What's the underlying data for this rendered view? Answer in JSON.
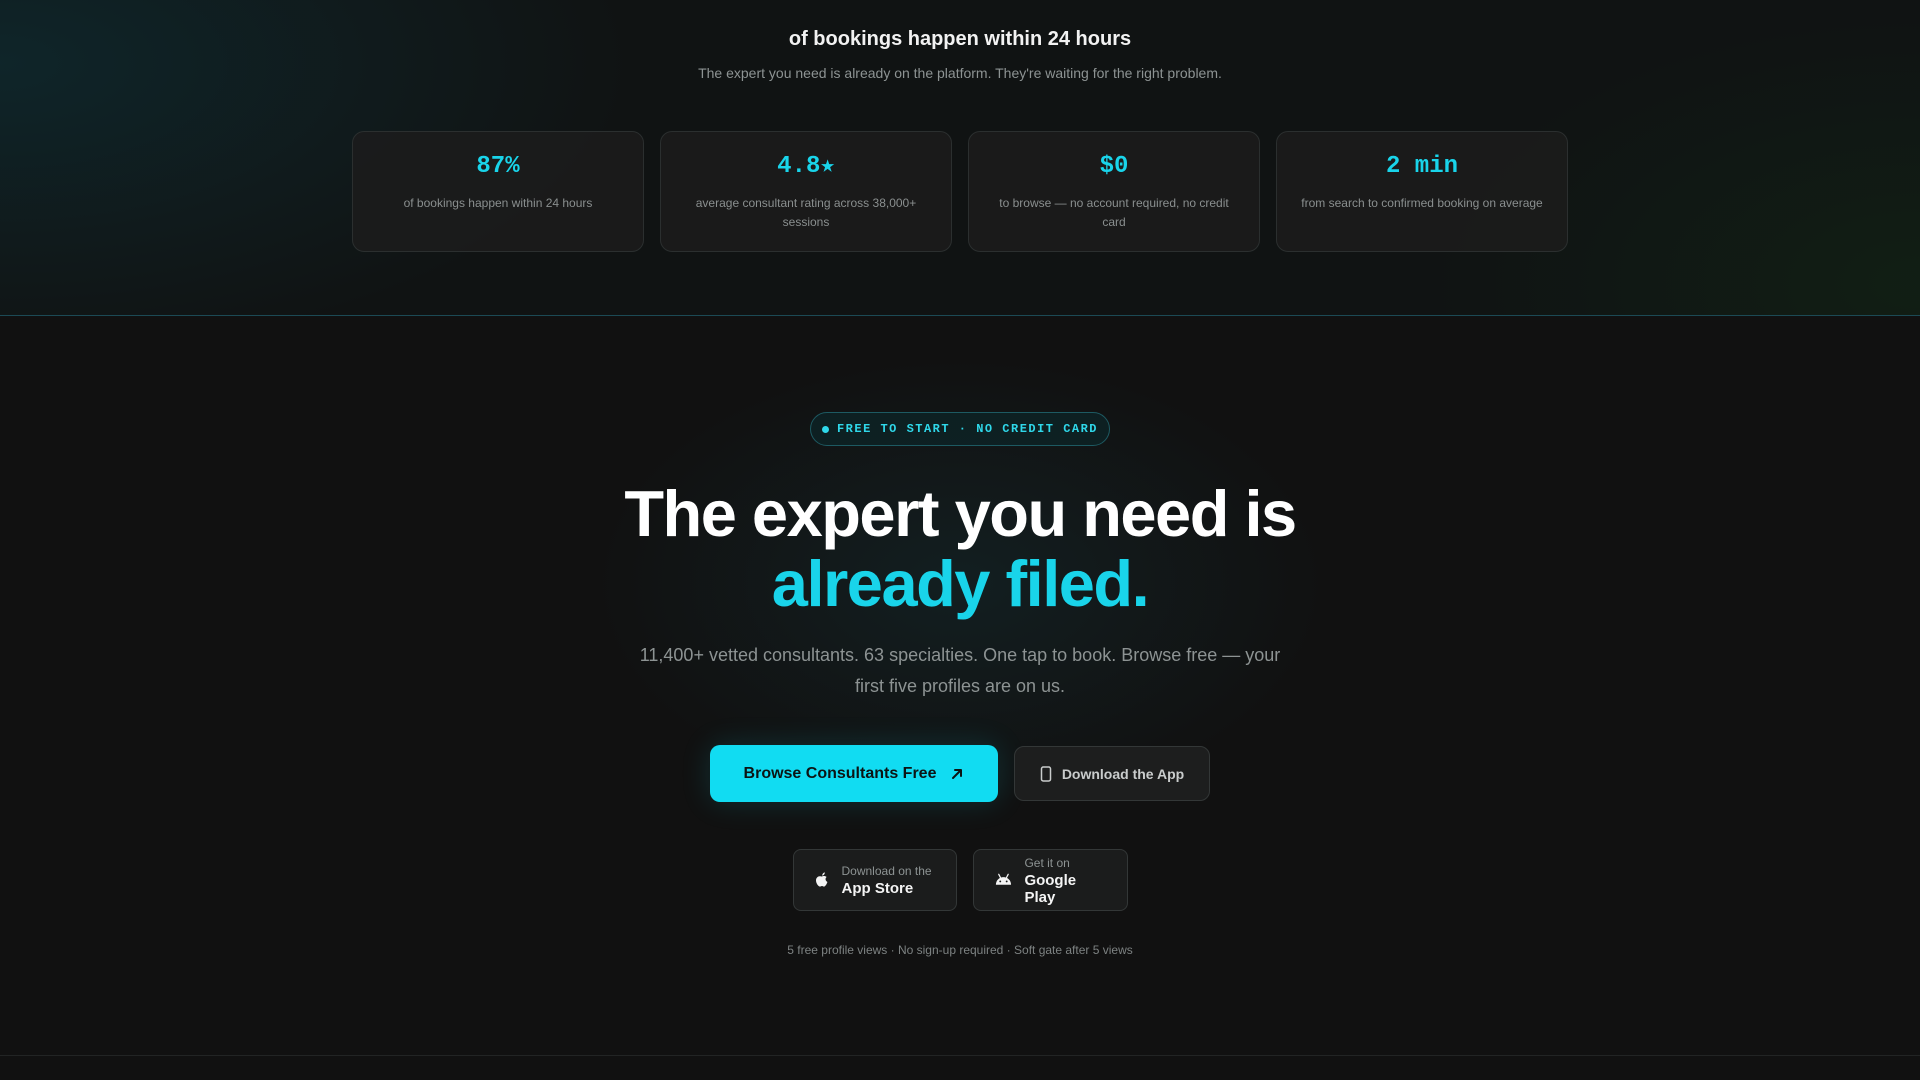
{
  "stats_section": {
    "title": "of bookings happen within 24 hours",
    "subtitle": "The expert you need is already on the platform. They're waiting for the right problem.",
    "cards": [
      {
        "value": "87%",
        "description": "of bookings happen within 24 hours"
      },
      {
        "value": "4.8★",
        "description": "average consultant rating across 38,000+ sessions"
      },
      {
        "value": "$0",
        "description": "to browse — no account required, no credit card"
      },
      {
        "value": "2 min",
        "description": "from search to confirmed booking on average"
      }
    ]
  },
  "hero": {
    "badge": "FREE TO START · NO CREDIT CARD",
    "headline_line1": "The expert you need is",
    "headline_line2": "already filed.",
    "subheadline": "11,400+ vetted consultants. 63 specialties. One tap to book. Browse free — your first five profiles are on us.",
    "primary_button": "Browse Consultants Free",
    "secondary_button": "Download the App",
    "app_store": {
      "small": "Download on the",
      "big": "App Store"
    },
    "google_play": {
      "small": "Get it on",
      "big": "Google Play"
    },
    "fine_print": "5 free profile views · No sign-up required · Soft gate after 5 views"
  },
  "colors": {
    "accent": "#19d4ea",
    "background": "#111111",
    "card": "#1c1c1c",
    "muted_text": "#8d9393"
  },
  "icons": {
    "primary_button": "arrow-up-right-icon",
    "secondary_button": "phone-icon",
    "app_store": "apple-icon",
    "google_play": "android-icon",
    "badge": "dot-icon"
  }
}
